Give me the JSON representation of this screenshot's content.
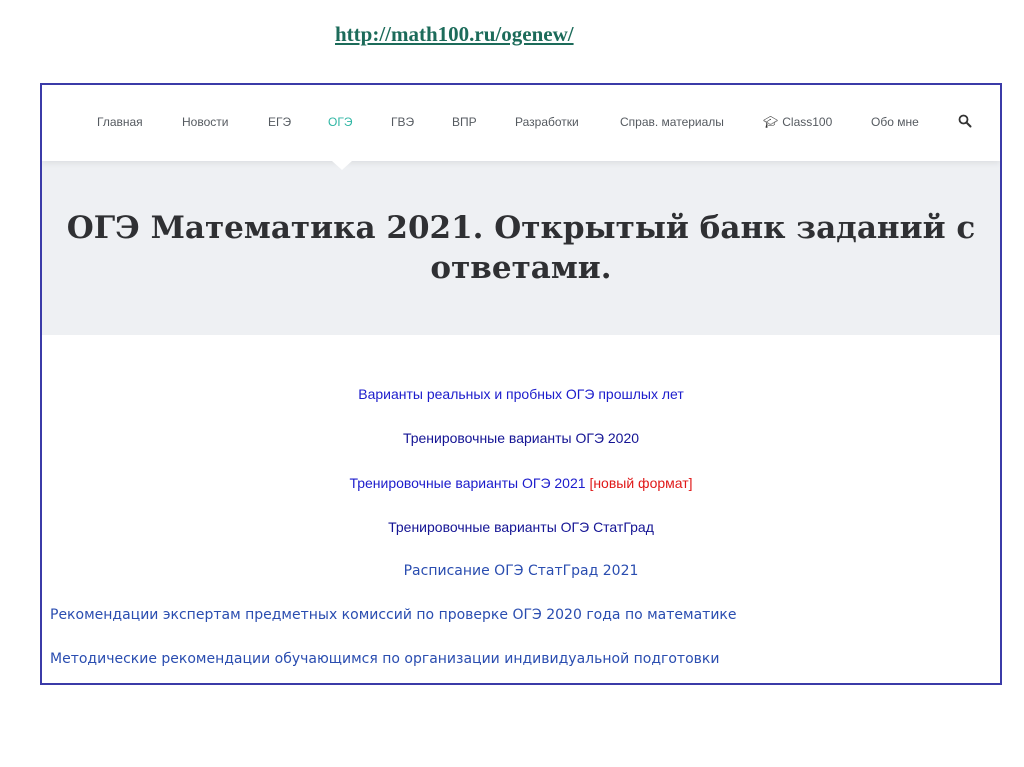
{
  "slide": {
    "source_url": "http://math100.ru/ogenew/"
  },
  "nav": {
    "items": [
      {
        "label": "Главная"
      },
      {
        "label": "Новости"
      },
      {
        "label": "ЕГЭ"
      },
      {
        "label": "ОГЭ",
        "active": true
      },
      {
        "label": "ГВЭ"
      },
      {
        "label": "ВПР"
      },
      {
        "label": "Разработки"
      },
      {
        "label": "Справ. материалы"
      },
      {
        "label": "Class100",
        "icon": "graduation-cap-icon"
      },
      {
        "label": "Обо мне"
      }
    ],
    "search_icon": "search-icon",
    "active_color": "#2fb6a4"
  },
  "hero": {
    "title": "ОГЭ Математика 2021. Открытый банк заданий с ответами."
  },
  "links": [
    {
      "text": "Варианты реальных и пробных ОГЭ прошлых лет"
    },
    {
      "text": "Тренировочные варианты ОГЭ 2020"
    },
    {
      "text": "Тренировочные варианты ОГЭ 2021 ",
      "suffix": "[новый формат]"
    },
    {
      "text": "Тренировочные варианты ОГЭ СтатГрад"
    },
    {
      "text": "Расписание ОГЭ СтатГрад 2021"
    },
    {
      "text": "Рекомендации экспертам предметных комиссий по проверке ОГЭ 2020 года по математике"
    },
    {
      "text": "Методические рекомендации обучающимся по организации индивидуальной подготовки"
    }
  ],
  "colors": {
    "frame_border": "#3b3ba8",
    "link_blue": "#1c1ccc",
    "highlight_red": "#e01818",
    "url_green": "#1c6b5a"
  }
}
